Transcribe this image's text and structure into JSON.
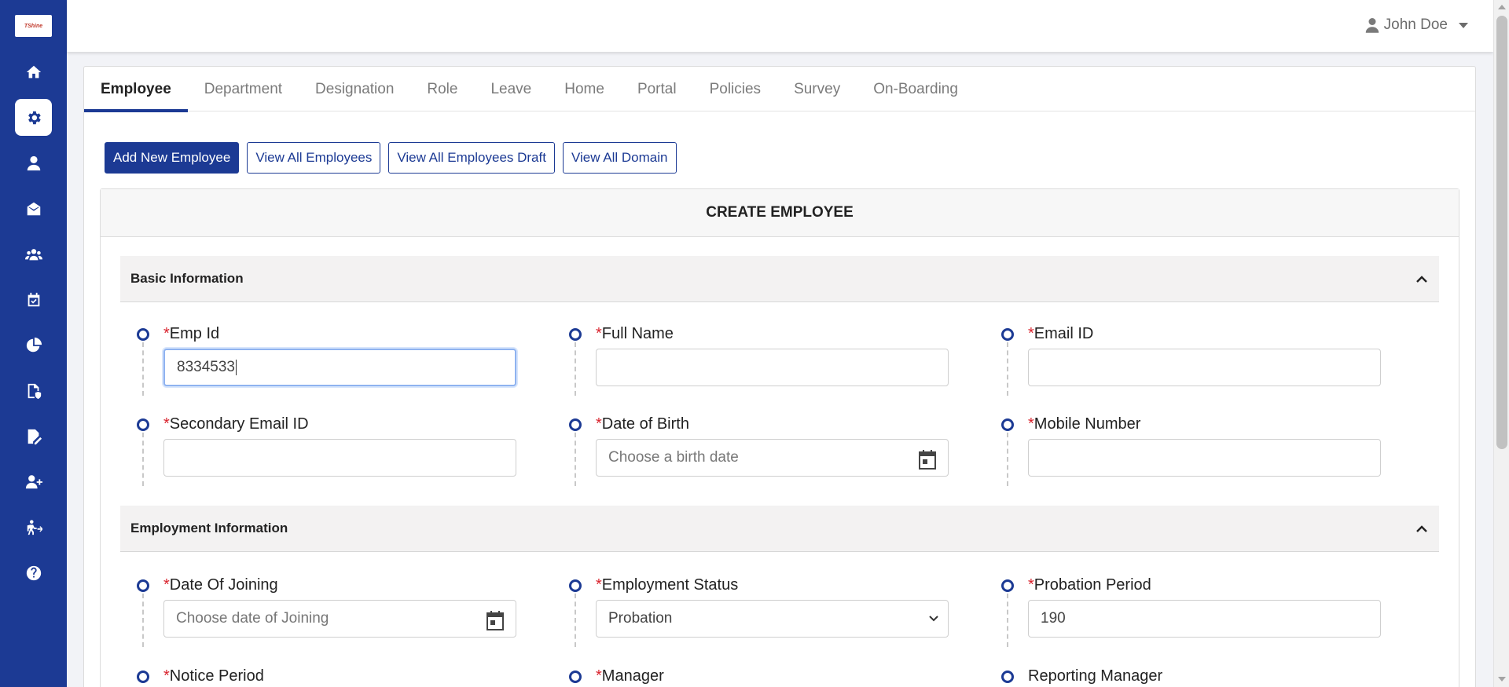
{
  "logo": {
    "text": "TShine"
  },
  "user": {
    "name": "John Doe"
  },
  "sidebar": {
    "items": [
      {
        "icon": "home-icon"
      },
      {
        "icon": "gear-icon",
        "active": true
      },
      {
        "icon": "user-icon"
      },
      {
        "icon": "mail-icon"
      },
      {
        "icon": "users-icon"
      },
      {
        "icon": "calendar-check-icon"
      },
      {
        "icon": "pie-chart-icon"
      },
      {
        "icon": "file-shield-icon"
      },
      {
        "icon": "file-edit-icon"
      },
      {
        "icon": "user-plus-icon"
      },
      {
        "icon": "person-exit-icon"
      },
      {
        "icon": "help-icon"
      }
    ]
  },
  "tabs": [
    "Employee",
    "Department",
    "Designation",
    "Role",
    "Leave",
    "Home",
    "Portal",
    "Policies",
    "Survey",
    "On-Boarding"
  ],
  "buttons": {
    "add_new": "Add New Employee",
    "view_all": "View All Employees",
    "view_drafts": "View All Employees Draft",
    "view_domain": "View All Domain"
  },
  "panel_title": "CREATE EMPLOYEE",
  "sections": {
    "basic": "Basic Information",
    "employment": "Employment Information"
  },
  "fields": {
    "emp_id": {
      "label": "Emp Id",
      "value": "8334533",
      "required": "*"
    },
    "full_name": {
      "label": "Full Name",
      "value": "",
      "required": "*"
    },
    "email_id": {
      "label": "Email ID",
      "value": "",
      "required": "*"
    },
    "secondary_email": {
      "label": "Secondary Email ID",
      "value": "",
      "required": "*"
    },
    "dob": {
      "label": "Date of Birth",
      "placeholder": "Choose a birth date",
      "required": "*"
    },
    "mobile": {
      "label": "Mobile Number",
      "value": "",
      "required": "*"
    },
    "doj": {
      "label": "Date Of Joining",
      "placeholder": "Choose date of Joining",
      "required": "*"
    },
    "employment_status": {
      "label": "Employment Status",
      "value": "Probation",
      "required": "*"
    },
    "probation_period": {
      "label": "Probation Period",
      "value": "190",
      "required": "*"
    },
    "notice_period": {
      "label": "Notice Period",
      "required": "*"
    },
    "manager": {
      "label": "Manager",
      "required": "*"
    },
    "reporting_manager": {
      "label": "Reporting Manager"
    }
  },
  "colors": {
    "primary": "#1c3a94",
    "required": "#d9232d"
  }
}
